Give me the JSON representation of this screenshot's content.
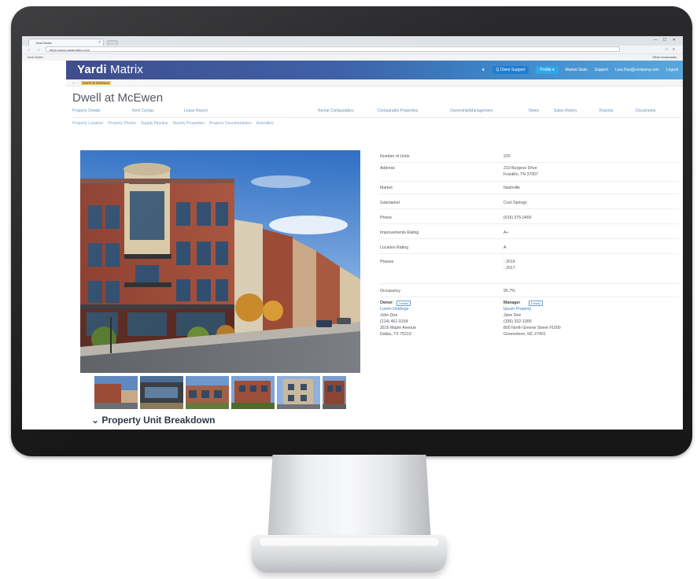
{
  "browser": {
    "tab_title": "Yardi Matrix",
    "url": "https://www.yardimatrix.com/",
    "bookmark": "Yardi Matrix",
    "bookmark_right": "Other bookmarks",
    "window_controls": "— ☐ ✕"
  },
  "nav": {
    "logo_part1": "Yardi",
    "logo_part2": " Matrix",
    "items": [
      "★",
      "Q Client Support",
      "Profile ▾",
      "Market Stats",
      "Support",
      "Lisa.Doe@company.com",
      "Logout"
    ]
  },
  "breadcrumb": {
    "items": [
      "Dwell at McEwen"
    ]
  },
  "property": {
    "title": "Dwell at McEwen",
    "subtabs": [
      "Property Details",
      "Rent Comps",
      "Lease Report",
      "Rental Comparables",
      "Comparable Properties",
      "Ownership/Management",
      "Notes",
      "Sales History",
      "Reports",
      "Documents"
    ],
    "links": [
      "Property Location",
      "Property Photos",
      "Supply Pipeline",
      "Nearby Properties",
      "Property Documentation",
      "Amenities"
    ]
  },
  "details": {
    "rows": [
      {
        "label": "Number of Units",
        "value": "220"
      },
      {
        "label": "Address",
        "value": "210 Burgess Drive",
        "value2": "Franklin, TN 37067"
      },
      {
        "label": "Market",
        "value": "Nashville"
      },
      {
        "label": "Submarket",
        "value": "Cool Springs"
      },
      {
        "label": "Phone",
        "value": "(615) 375-3400"
      },
      {
        "label": "Improvements Rating",
        "value": "A+"
      },
      {
        "label": "Location Rating",
        "value": "A"
      },
      {
        "label": "Phases",
        "value": "- 2016",
        "value2": "- 2017"
      },
      {
        "label": "Occupancy",
        "value": "95.7%"
      }
    ],
    "owner": {
      "heading": "Owner",
      "button": "Details",
      "company": "Lorem Holdings",
      "name": "John Doe",
      "phone": "(214) 461-9154",
      "address1": "3516 Maple Avenue",
      "address2": "Dallas, TX 75219"
    },
    "manager": {
      "heading": "Manager",
      "button": "Details",
      "company": "Ipsum Property",
      "name": "Jane Doe",
      "phone": "(336) 332-1000",
      "address1": "800 North Greene Street #1000",
      "address2": "Greensboro, NC 27401"
    }
  },
  "section": {
    "breakdown_title": "Property Unit Breakdown"
  },
  "colors": {
    "nav_start": "#2f3f84",
    "nav_end": "#5aa7de",
    "link": "#3f7ac0",
    "title": "#4a4f57"
  }
}
